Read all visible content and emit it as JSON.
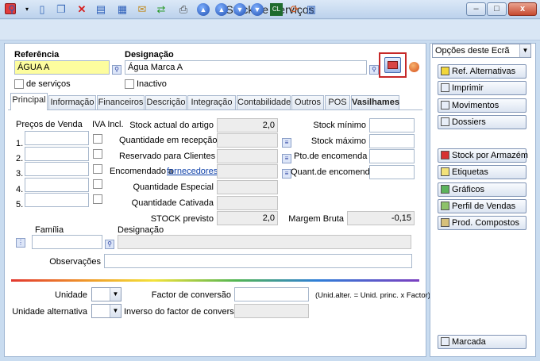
{
  "window": {
    "title": "Stocks e Serviços",
    "minimize": "–",
    "maximize": "□",
    "close": "x"
  },
  "toolbar": {
    "icons": [
      "search-icon",
      "new-document-icon",
      "copy-document-icon",
      "delete-icon",
      "edit-icon",
      "grid-icon",
      "mail-icon",
      "refresh-icon",
      "print-preview-icon",
      "first-record-icon",
      "previous-record-icon",
      "next-record-icon",
      "last-record-icon",
      "calendar-icon",
      "rotate-icon",
      "chart-icon"
    ]
  },
  "header": {
    "referencia_label": "Referência",
    "referencia_value": "ÁGUA A",
    "designacao_label": "Designação",
    "designacao_value": "Água Marca A",
    "servicos_label": "de serviços",
    "inactivo_label": "Inactivo"
  },
  "tabs": [
    {
      "label": "Principal",
      "active": true
    },
    {
      "label": "Informação"
    },
    {
      "label": "Financeiros"
    },
    {
      "label": "Descrição"
    },
    {
      "label": "Integração"
    },
    {
      "label": "Contabilidade"
    },
    {
      "label": "Outros"
    },
    {
      "label": "POS"
    },
    {
      "label": "Vasilhames",
      "bold": true
    }
  ],
  "precos": {
    "label": "Preços de Venda",
    "iva_label": "IVA Incl.",
    "rows": [
      "1.",
      "2.",
      "3.",
      "4.",
      "5."
    ]
  },
  "stock": {
    "actual_label": "Stock actual do artigo",
    "actual_value": "2,0",
    "recepcao_label": "Quantidade em recepção",
    "reservado_label": "Reservado para Clientes",
    "encomendado_label": "Encomendado a",
    "encomendado_link": "fornecedores",
    "especial_label": "Quantidade Especial",
    "cativada_label": "Quantidade Cativada",
    "previsto_label": "STOCK previsto",
    "previsto_value": "2,0",
    "minimo_label": "Stock mínimo",
    "maximo_label": "Stock máximo",
    "pto_label": "Pto.de encomenda",
    "quant_label": "Quant.de encomenda",
    "margem_label": "Margem Bruta",
    "margem_value": "-0,15"
  },
  "familia": {
    "label": "Família",
    "designacao_label": "Designação"
  },
  "observacoes_label": "Observações",
  "unidades": {
    "unidade_label": "Unidade",
    "alternativa_label": "Unidade alternativa",
    "factor_label": "Factor de conversão",
    "inverso_label": "Inverso do factor de conversão",
    "formula": "(Unid.alter. = Unid. princ. x Factor)"
  },
  "sidebar": {
    "dropdown": "Opções deste Ecrã",
    "buttons": [
      {
        "label": "Ref. Alternativas",
        "icon": "pencil-icon"
      },
      {
        "label": "Imprimir",
        "icon": "printer-icon"
      },
      {
        "label": "Movimentos",
        "icon": "list-icon"
      },
      {
        "label": "Dossiers",
        "icon": "folder-icon"
      },
      {
        "label": "Stock por Armazém",
        "icon": "boxes-icon"
      },
      {
        "label": "Etiquetas",
        "icon": "label-icon"
      },
      {
        "label": "Gráficos",
        "icon": "chart-icon"
      },
      {
        "label": "Perfil de Vendas",
        "icon": "profile-icon"
      },
      {
        "label": "Prod. Compostos",
        "icon": "product-icon"
      }
    ],
    "marcada": "Marcada"
  }
}
